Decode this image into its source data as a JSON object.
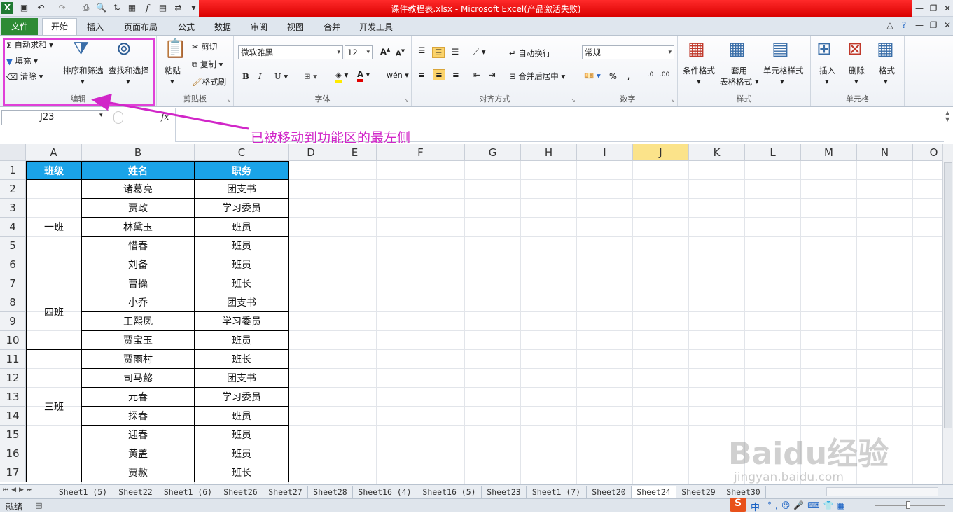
{
  "window": {
    "title": "课件教程表.xlsx - Microsoft Excel(产品激活失败)"
  },
  "tabs": [
    "文件",
    "开始",
    "插入",
    "页面布局",
    "公式",
    "数据",
    "审阅",
    "视图",
    "合并",
    "开发工具"
  ],
  "ribbon": {
    "edit": {
      "autosum": "自动求和",
      "fill": "填充",
      "clear": "清除",
      "sort": "排序和筛选",
      "find": "查找和选择",
      "label": "编辑"
    },
    "clipboard": {
      "paste": "粘贴",
      "cut": "剪切",
      "copy": "复制",
      "format_painter": "格式刷",
      "label": "剪贴板"
    },
    "font": {
      "name": "微软雅黑",
      "size": "12",
      "label": "字体"
    },
    "align": {
      "wrap": "自动换行",
      "merge": "合并后居中",
      "label": "对齐方式"
    },
    "number": {
      "format": "常规",
      "label": "数字"
    },
    "styles": {
      "cond": "条件格式",
      "table_a": "套用",
      "table_b": "表格格式",
      "cell_styles": "单元格样式",
      "label": "样式"
    },
    "cells": {
      "insert": "插入",
      "delete": "删除",
      "format": "格式",
      "label": "单元格"
    }
  },
  "formula": {
    "namebox": "J23",
    "fx": "fx"
  },
  "annotation": "已被移动到功能区的最左侧",
  "columns": [
    "A",
    "B",
    "C",
    "D",
    "E",
    "F",
    "G",
    "H",
    "I",
    "J",
    "K",
    "L",
    "M",
    "N",
    "O"
  ],
  "rows": [
    "1",
    "2",
    "3",
    "4",
    "5",
    "6",
    "7",
    "8",
    "9",
    "10",
    "11",
    "12",
    "13",
    "14",
    "15",
    "16",
    "17"
  ],
  "table": {
    "headers": [
      "班级",
      "姓名",
      "职务"
    ],
    "classes": [
      "一班",
      "四班",
      "三班"
    ],
    "names": [
      "诸葛亮",
      "贾政",
      "林黛玉",
      "惜春",
      "刘备",
      "曹操",
      "小乔",
      "王熙凤",
      "贾宝玉",
      "贾雨村",
      "司马懿",
      "元春",
      "探春",
      "迎春",
      "黄盖",
      "贾赦"
    ],
    "roles": [
      "团支书",
      "学习委员",
      "班员",
      "班员",
      "班员",
      "班长",
      "团支书",
      "学习委员",
      "班员",
      "班长",
      "团支书",
      "学习委员",
      "班员",
      "班员",
      "班员",
      "班长"
    ]
  },
  "sheets": [
    "Sheet1 (5)",
    "Sheet22",
    "Sheet1 (6)",
    "Sheet26",
    "Sheet27",
    "Sheet28",
    "Sheet16 (4)",
    "Sheet16 (5)",
    "Sheet23",
    "Sheet1 (7)",
    "Sheet20",
    "Sheet24",
    "Sheet29",
    "Sheet30"
  ],
  "active_sheet": "Sheet24",
  "status": {
    "ready": "就绪",
    "ime": "中"
  },
  "watermark": {
    "brand": "Baidu经验",
    "url": "jingyan.baidu.com"
  },
  "colors": {
    "accent": "#d126c8",
    "header_fill": "#1aa3e8",
    "title_red": "#e00000",
    "file_green": "#2e8b35"
  }
}
